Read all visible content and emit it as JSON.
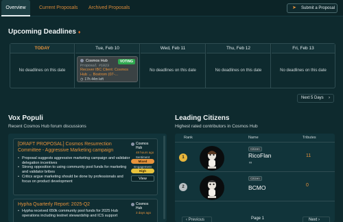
{
  "nav": {
    "tabs": [
      {
        "label": "Overview"
      },
      {
        "label": "Current Proposals"
      },
      {
        "label": "Archived Proposals"
      }
    ],
    "submit_label": "Submit a Proposal"
  },
  "deadlines": {
    "title": "Upcoming Deadlines",
    "days": [
      {
        "label": "TODAY",
        "empty_text": "No deadlines on this date"
      },
      {
        "label": "Tue, Feb 10"
      },
      {
        "label": "Wed, Feb 11",
        "empty_text": "No deadlines on this date"
      },
      {
        "label": "Thu, Feb 12",
        "empty_text": "No deadlines on this date"
      },
      {
        "label": "Fri, Feb 13",
        "empty_text": "No deadlines on this date"
      }
    ],
    "proposal": {
      "chain": "Cosmos Hub",
      "status": "VOTING",
      "id": "Proposal #1023",
      "title": "Recover IBC Client: Cosmos Hub ↔ Bostrom (07-...",
      "time_left": "17h 44m left"
    },
    "next_label": "Next 5 Days"
  },
  "vox": {
    "title": "Vox Populi",
    "subtitle": "Recent Cosmos Hub forum discussions",
    "posts": [
      {
        "title": "[DRAFT PROPOSAL] Cosmos Resurrection Committee - Aggressive Marketing campaign",
        "bullets": [
          "Proposal suggests aggressive marketing campaign and validator delegation incentives",
          "Strong opposition to using community pool funds for marketing and validator bribes",
          "Critics argue marketing should be done by professionals and focus on product development"
        ],
        "chain": "Cosmos Hub",
        "ago": "48 hours ago",
        "sentiment_label": "Sentiment",
        "sentiment": "Mixed",
        "engagement_label": "Engagement",
        "engagement": "High",
        "view_label": "View"
      },
      {
        "title": "Hypha Quarterly Report: 2025-Q2",
        "bullets": [
          "Hypha received 650k community pool funds for 2025 Hub operations including testnet stewardship and ICS support"
        ],
        "chain": "Cosmos Hub",
        "ago": "3 days ago"
      }
    ]
  },
  "leaders": {
    "title": "Leading Citizens",
    "subtitle": "Highest rated contributors in Cosmos Hub",
    "columns": [
      "Rank",
      "Name",
      "Tributes"
    ],
    "rows": [
      {
        "rank": "1",
        "badge": "Citizen",
        "name": "RicoFlan",
        "tributes": "11"
      },
      {
        "rank": "2",
        "badge": "Citizen",
        "name": "BCMO",
        "tributes": "0"
      }
    ],
    "pager": {
      "prev": "Previous",
      "page": "Page 1",
      "next": "Next"
    }
  }
}
